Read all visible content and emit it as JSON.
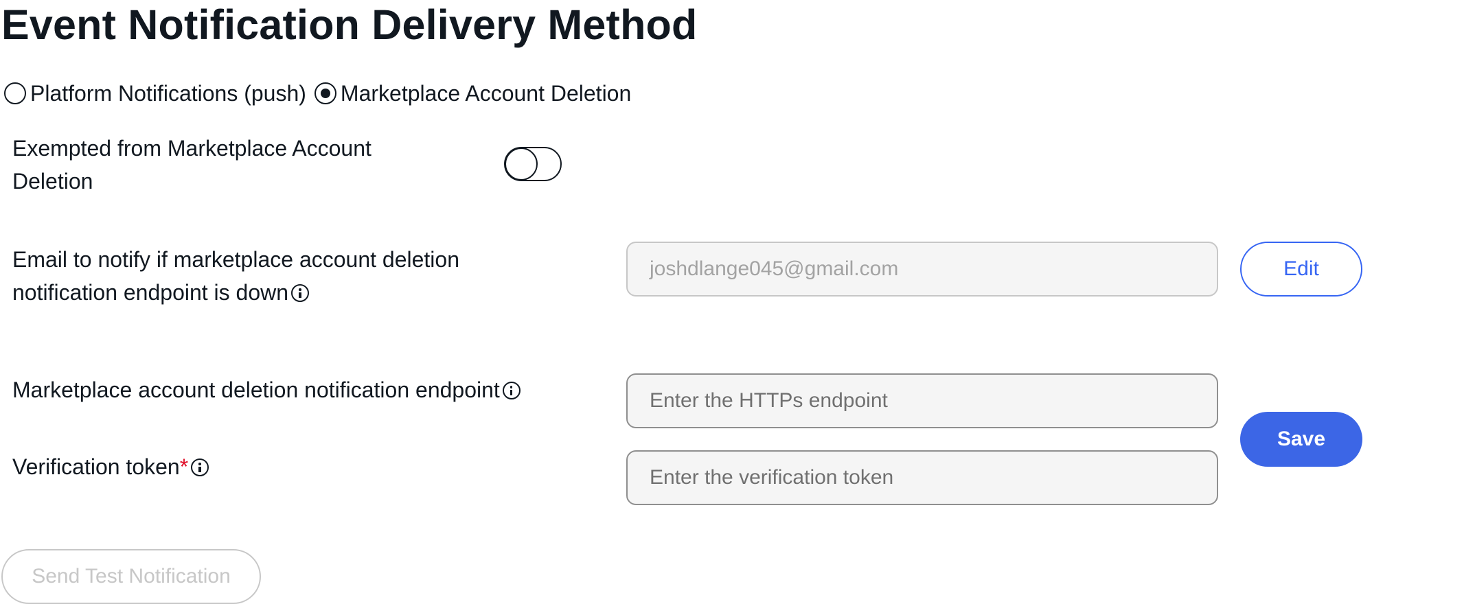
{
  "page_title": "Event Notification Delivery Method",
  "delivery_options": [
    {
      "label": "Platform Notifications (push)",
      "selected": false
    },
    {
      "label": "Marketplace Account Deletion",
      "selected": true
    }
  ],
  "exempt": {
    "label_line1": "Exempted from Marketplace Account",
    "label_line2": "Deletion",
    "enabled": false
  },
  "email": {
    "label_line1": "Email to notify if marketplace account deletion",
    "label_line2": "notification endpoint is down",
    "value": "joshdlange045@gmail.com",
    "edit_label": "Edit"
  },
  "endpoint": {
    "label": "Marketplace account deletion notification endpoint",
    "placeholder": "Enter the HTTPs endpoint"
  },
  "token": {
    "label": "Verification token",
    "required_mark": "*",
    "placeholder": "Enter the verification token"
  },
  "save_label": "Save",
  "send_test_label": "Send Test Notification",
  "colors": {
    "accent": "#3665f3",
    "save_bg": "#3c66e6",
    "required": "#e0102a"
  }
}
